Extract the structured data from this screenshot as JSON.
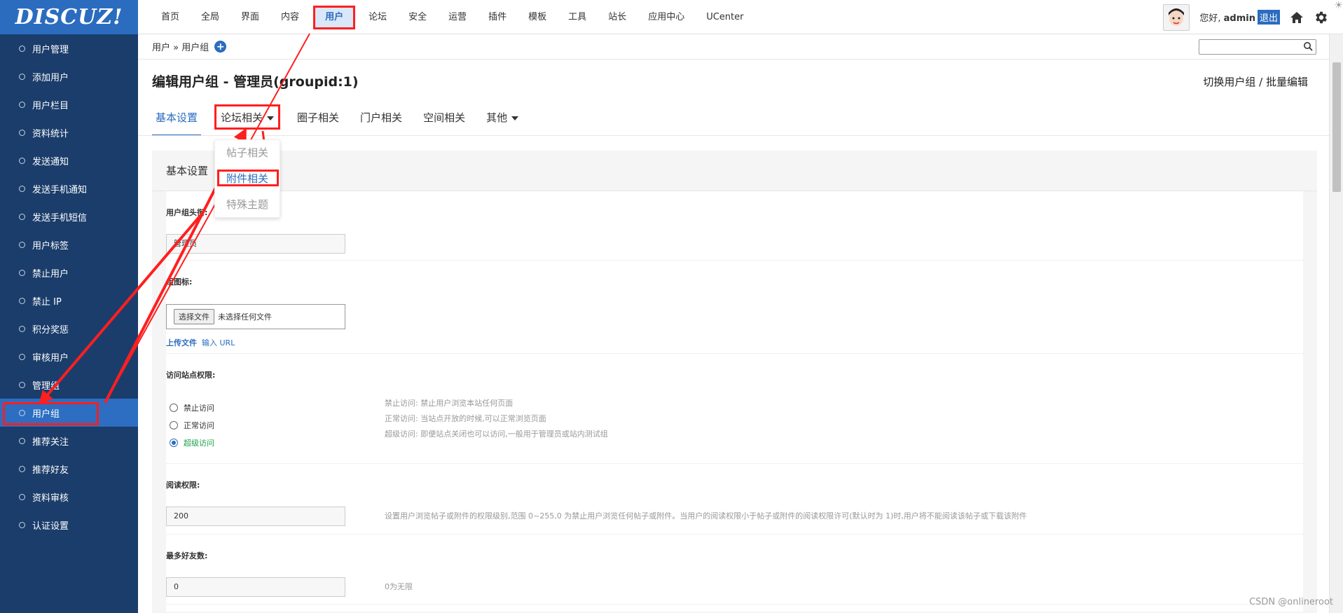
{
  "logo": "DISCUZ!",
  "topnav": [
    "首页",
    "全局",
    "界面",
    "内容",
    "用户",
    "论坛",
    "安全",
    "运营",
    "插件",
    "模板",
    "工具",
    "站长",
    "应用中心",
    "UCenter"
  ],
  "topnav_active": "用户",
  "user": {
    "greeting": "您好,",
    "name": "admin",
    "logout": "退出"
  },
  "sidebar": [
    "用户管理",
    "添加用户",
    "用户栏目",
    "资料统计",
    "发送通知",
    "发送手机通知",
    "发送手机短信",
    "用户标签",
    "禁止用户",
    "禁止 IP",
    "积分奖惩",
    "审核用户",
    "管理组",
    "用户组",
    "推荐关注",
    "推荐好友",
    "资料审核",
    "认证设置"
  ],
  "sidebar_active": "用户组",
  "breadcrumb": "用户 » 用户组",
  "page": {
    "title": "编辑用户组 - 管理员(groupid:1)",
    "switch_link": "切换用户组 / 批量编辑"
  },
  "tabs": [
    {
      "label": "基本设置",
      "active": true,
      "dropdown": false
    },
    {
      "label": "论坛相关",
      "active": false,
      "dropdown": true
    },
    {
      "label": "圈子相关",
      "active": false,
      "dropdown": false
    },
    {
      "label": "门户相关",
      "active": false,
      "dropdown": false
    },
    {
      "label": "空间相关",
      "active": false,
      "dropdown": false
    },
    {
      "label": "其他",
      "active": false,
      "dropdown": true
    }
  ],
  "dropdown": [
    "帖子相关",
    "附件相关",
    "特殊主题"
  ],
  "panel_title": "基本设置",
  "fields": {
    "group_title": {
      "label": "用户组头衔:",
      "value": "管理员"
    },
    "group_icon": {
      "label": "组图标:",
      "file_button": "选择文件",
      "file_status": "未选择任何文件",
      "upload": "上传文件",
      "url": "输入 URL"
    },
    "access": {
      "label": "访问站点权限:",
      "options": [
        "禁止访问",
        "正常访问",
        "超级访问"
      ],
      "selected": "超级访问",
      "hints": [
        "禁止访问: 禁止用户浏览本站任何页面",
        "正常访问: 当站点开放的时候,可以正常浏览页面",
        "超级访问: 即便站点关闭也可以访问,一般用于管理员或站内测试组"
      ]
    },
    "read_perm": {
      "label": "阅读权限:",
      "value": "200",
      "hint": "设置用户浏览帖子或附件的权限级别,范围 0~255,0 为禁止用户浏览任何帖子或附件。当用户的阅读权限小于帖子或附件的阅读权限许可(默认时为 1)时,用户将不能阅读该帖子或下载该附件"
    },
    "max_friends": {
      "label": "最多好友数:",
      "value": "0",
      "hint": "0为无限"
    }
  },
  "watermark": "CSDN @onlineroot",
  "colors": {
    "sidebar": "#1b3d6b",
    "accent": "#2b6cbf",
    "annotation": "#ff1f1f"
  }
}
